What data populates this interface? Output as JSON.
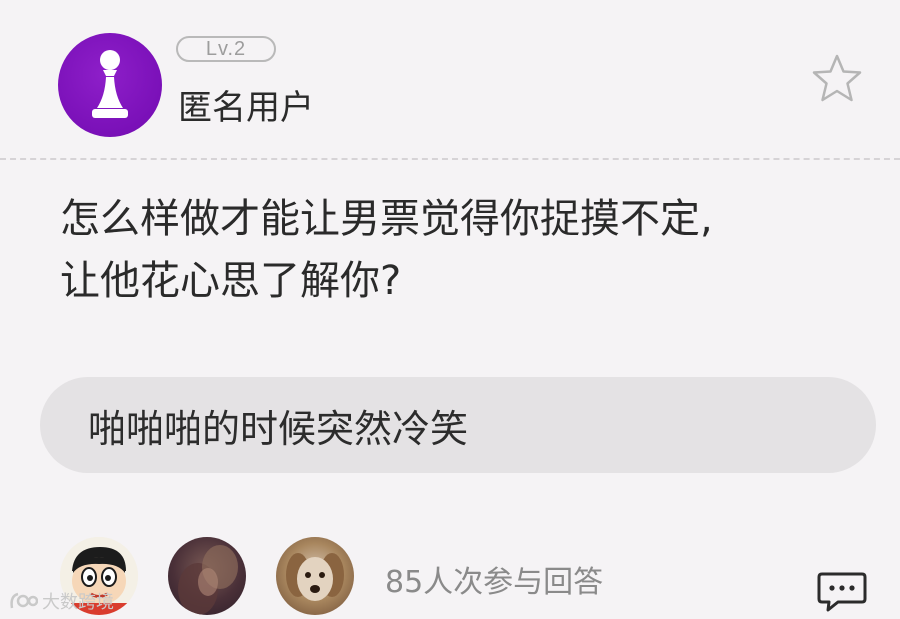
{
  "post": {
    "level_badge": "Lv.2",
    "username": "匿名用户",
    "question_line1": "怎么样做才能让男票觉得你捉摸不定,",
    "question_line2": "让他花心思了解你?",
    "answer": "啪啪啪的时候突然冷笑"
  },
  "footer": {
    "participants": "85人次参与回答"
  },
  "watermark": {
    "text": "大数跨境"
  },
  "icons": {
    "avatar": "pawn-icon",
    "favorite": "star-icon",
    "comment": "comment-icon",
    "watermark_logo": "logo-icon"
  },
  "colors": {
    "avatar_purple": "#7a10b8",
    "background": "#f5f3f5",
    "answer_bubble": "#e4e2e4",
    "muted_text": "#8a8a8a"
  }
}
